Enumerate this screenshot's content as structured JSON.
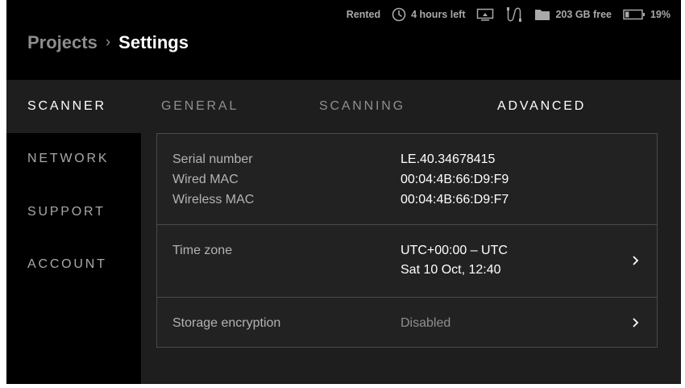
{
  "status_bar": {
    "rental": "Rented",
    "time_left": "4 hours left",
    "storage_free": "203 GB free",
    "battery": "19%"
  },
  "breadcrumb": {
    "parent": "Projects",
    "separator": "›",
    "current": "Settings"
  },
  "sidebar": {
    "items": [
      {
        "label": "SCANNER"
      },
      {
        "label": "NETWORK"
      },
      {
        "label": "SUPPORT"
      },
      {
        "label": "ACCOUNT"
      }
    ],
    "active": "SCANNER"
  },
  "tabs": [
    {
      "label": "GENERAL"
    },
    {
      "label": "SCANNING"
    },
    {
      "label": "ADVANCED"
    }
  ],
  "active_tab": "ADVANCED",
  "device_info": {
    "serial_label": "Serial number",
    "serial_value": "LE.40.34678415",
    "wired_mac_label": "Wired MAC",
    "wired_mac_value": "00:04:4B:66:D9:F9",
    "wireless_mac_label": "Wireless MAC",
    "wireless_mac_value": "00:04:4B:66:D9:F7"
  },
  "time_zone": {
    "label": "Time zone",
    "value": "UTC+00:00 – UTC",
    "datetime": "Sat 10 Oct, 12:40"
  },
  "storage_encryption": {
    "label": "Storage encryption",
    "value": "Disabled"
  },
  "colors": {
    "background": "#000000",
    "panel": "#1e1e1e",
    "card": "#222222",
    "border": "#4a4a4a",
    "text_primary": "#ffffff",
    "text_secondary": "#b3b3b3",
    "text_muted": "#8f8f8f"
  },
  "icons": {
    "time": "clock-icon",
    "display": "display-icon",
    "cable": "cable-icon",
    "storage": "folder-icon",
    "battery": "battery-icon",
    "row_chevron": "chevron-right-icon"
  }
}
